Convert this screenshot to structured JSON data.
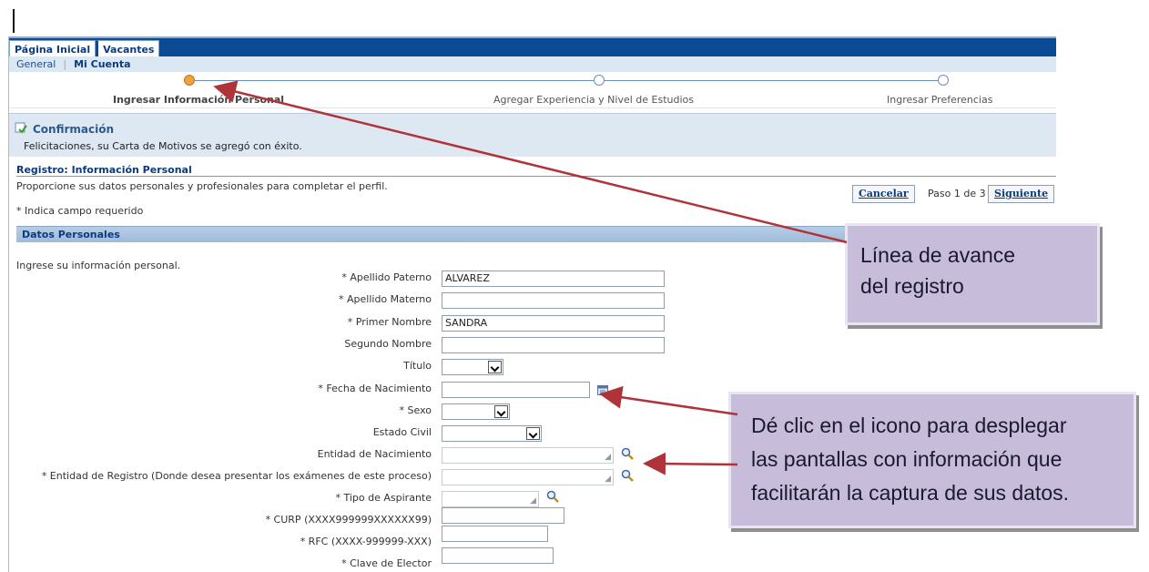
{
  "header": {
    "tabs": [
      {
        "label": "Página Inicial",
        "active": true
      },
      {
        "label": "Vacantes",
        "active": false
      }
    ],
    "subnav": [
      {
        "label": "General",
        "active": false
      },
      {
        "label": "Mi Cuenta",
        "active": true
      }
    ]
  },
  "train": {
    "steps": [
      {
        "label": "Ingresar Información Personal",
        "current": true
      },
      {
        "label": "Agregar Experiencia y Nivel de Estudios",
        "current": false
      },
      {
        "label": "Ingresar Preferencias",
        "current": false
      }
    ]
  },
  "confirmation": {
    "title": "Confirmación",
    "message": "Felicitaciones, su Carta de Motivos se agregó con éxito."
  },
  "page": {
    "title": "Registro: Información Personal",
    "description": "Proporcione sus datos personales y profesionales para completar el perfil.",
    "required_note": "* Indica campo requerido",
    "step_indicator": "Paso 1 de 3",
    "cancel_label": "Cancelar",
    "next_label": "Siguiente"
  },
  "section": {
    "title": "Datos Personales",
    "intro": "Ingrese su información personal.",
    "fields": {
      "apellido_paterno": {
        "label": "* Apellido Paterno",
        "value": "ALVAREZ"
      },
      "apellido_materno": {
        "label": "* Apellido Materno",
        "value": ""
      },
      "primer_nombre": {
        "label": "* Primer Nombre",
        "value": "SANDRA"
      },
      "segundo_nombre": {
        "label": "Segundo Nombre",
        "value": ""
      },
      "titulo": {
        "label": "Título",
        "value": ""
      },
      "fecha_nacimiento": {
        "label": "* Fecha de Nacimiento",
        "value": ""
      },
      "sexo": {
        "label": "* Sexo",
        "value": ""
      },
      "estado_civil": {
        "label": "Estado Civil",
        "value": ""
      },
      "entidad_nacimiento": {
        "label": "Entidad de Nacimiento",
        "value": ""
      },
      "entidad_registro": {
        "label": "* Entidad de Registro (Donde desea presentar los exámenes de este proceso)",
        "value": ""
      },
      "tipo_aspirante": {
        "label": "* Tipo de Aspirante",
        "value": ""
      },
      "curp": {
        "label": "* CURP (XXXX999999XXXXXX99)",
        "value": ""
      },
      "rfc": {
        "label": "* RFC (XXXX-999999-XXX)",
        "value": ""
      },
      "clave_elector": {
        "label": "* Clave de Elector",
        "value": ""
      }
    }
  },
  "annotations": {
    "progress_callout": "Línea de avance del registro",
    "progress_callout_line1": "Línea de avance",
    "progress_callout_line2": "del registro",
    "icons_callout_line1": "Dé clic en el icono para desplegar",
    "icons_callout_line2": "las pantallas con información que",
    "icons_callout_line3": "facilitarán la captura de sus datos."
  },
  "colors": {
    "brand_bar": "#0b4a94",
    "subnav_bg": "#dbe8f4",
    "current_step": "#f0a33c",
    "callout_bg": "#c8bcdb",
    "arrow": "#b0333a"
  }
}
